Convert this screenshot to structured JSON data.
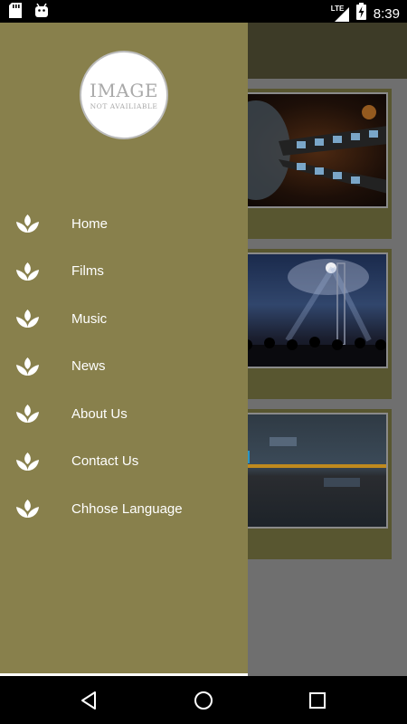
{
  "status_bar": {
    "time": "8:39",
    "network": "LTE",
    "icons": [
      "sd-card-icon",
      "android-icon",
      "signal-icon",
      "battery-charging-icon"
    ]
  },
  "drawer": {
    "avatar": {
      "line1": "IMAGE",
      "line2": "NOT AVAILIABLE"
    },
    "items": [
      {
        "label": "Home",
        "icon": "lotus-icon"
      },
      {
        "label": "Films",
        "icon": "lotus-icon"
      },
      {
        "label": "Music",
        "icon": "lotus-icon"
      },
      {
        "label": "News",
        "icon": "lotus-icon"
      },
      {
        "label": "About Us",
        "icon": "lotus-icon"
      },
      {
        "label": "Contact Us",
        "icon": "lotus-icon"
      },
      {
        "label": "Chhose Language",
        "icon": "lotus-icon"
      }
    ],
    "colors": {
      "background": "#88804c",
      "text": "#ffffff"
    }
  },
  "nav_bar": {
    "buttons": [
      "back-button",
      "home-button",
      "recents-button"
    ]
  }
}
